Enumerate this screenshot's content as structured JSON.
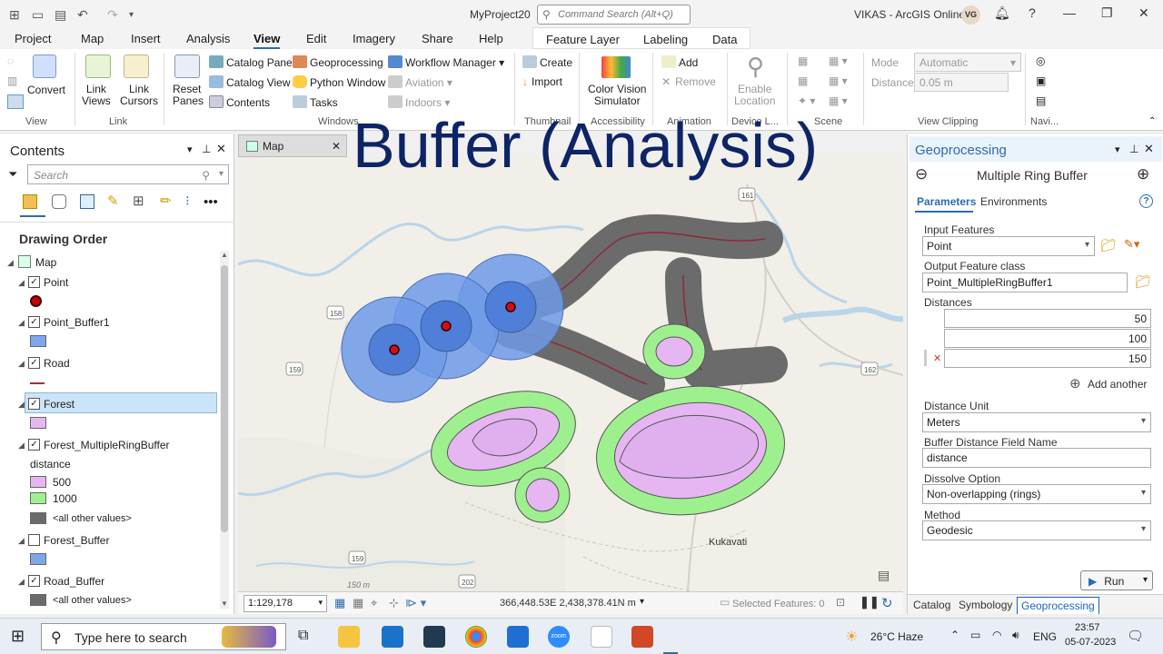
{
  "titlebar": {
    "project": "MyProject20",
    "search_placeholder": "Command Search (Alt+Q)",
    "account": "VIKAS - ArcGIS Online",
    "avatar": "VG",
    "help": "?"
  },
  "menu": {
    "items": [
      "Project",
      "Map",
      "Insert",
      "Analysis",
      "View",
      "Edit",
      "Imagery",
      "Share",
      "Help"
    ],
    "active": "View",
    "context_tabs": [
      "Feature Layer",
      "Labeling",
      "Data"
    ]
  },
  "ribbon": {
    "view_group": {
      "label": "View",
      "convert": "Convert"
    },
    "link_group": {
      "label": "Link",
      "link_views": "Link\nViews",
      "link_cursors": "Link\nCursors"
    },
    "windows_group": {
      "label": "Windows",
      "reset_panes": "Reset\nPanes",
      "catalog_pane": "Catalog Pane",
      "catalog_view": "Catalog View",
      "contents": "Contents",
      "geoprocessing": "Geoprocessing",
      "python_window": "Python Window",
      "tasks": "Tasks",
      "workflow_manager": "Workflow Manager",
      "aviation": "Aviation",
      "indoors": "Indoors"
    },
    "thumbnail_group": {
      "label": "Thumbnail",
      "create": "Create",
      "import": "Import"
    },
    "accessibility_group": {
      "label": "Accessibility",
      "cvs": "Color Vision\nSimulator"
    },
    "animation_group": {
      "label": "Animation",
      "add": "Add",
      "remove": "Remove"
    },
    "device_group": {
      "label": "Device L...",
      "enable": "Enable\nLocation"
    },
    "scene_group": {
      "label": "Scene"
    },
    "clipping_group": {
      "label": "View Clipping",
      "mode_label": "Mode",
      "mode_value": "Automatic",
      "distance_label": "Distance",
      "distance_value": "0.05  m"
    },
    "navi_group": {
      "label": "Navi..."
    }
  },
  "overlay_title": "Buffer (Analysis)",
  "contents": {
    "title": "Contents",
    "search_placeholder": "Search",
    "drawing_order": "Drawing Order",
    "map_label": "Map",
    "layers": [
      {
        "name": "Point",
        "checked": true
      },
      {
        "name": "Point_Buffer1",
        "checked": true
      },
      {
        "name": "Road",
        "checked": true
      },
      {
        "name": "Forest",
        "checked": true
      },
      {
        "name": "Forest_MultipleRingBuffer",
        "checked": true
      },
      {
        "name": "Forest_Buffer",
        "checked": false
      },
      {
        "name": "Road_Buffer",
        "checked": true
      }
    ],
    "ring_field": "distance",
    "ring_500": "500",
    "ring_1000": "1000",
    "other_values": "<all other values>",
    "other_values_2": "<all other values>"
  },
  "map": {
    "tab_label": "Map",
    "place_label": "Kukavati",
    "elevation_label": "150 m",
    "route_labels": [
      "158",
      "159",
      "162",
      "159",
      "202",
      "161"
    ],
    "scale": "1:129,178",
    "coords": "366,448.53E 2,438,378.41N m",
    "selected": "Selected Features: 0"
  },
  "geoprocessing": {
    "title": "Geoprocessing",
    "tool": "Multiple Ring Buffer",
    "tab_parameters": "Parameters",
    "tab_environments": "Environments",
    "input_label": "Input Features",
    "input_value": "Point",
    "output_label": "Output Feature class",
    "output_value": "Point_MultipleRingBuffer1",
    "distances_label": "Distances",
    "distances": [
      "50",
      "100",
      "150"
    ],
    "add_another": "Add another",
    "unit_label": "Distance Unit",
    "unit_value": "Meters",
    "field_label": "Buffer Distance Field Name",
    "field_value": "distance",
    "dissolve_label": "Dissolve Option",
    "dissolve_value": "Non-overlapping (rings)",
    "method_label": "Method",
    "method_value": "Geodesic",
    "run": "Run",
    "bottom_tabs": [
      "Catalog",
      "Symbology",
      "Geoprocessing"
    ]
  },
  "taskbar": {
    "search_placeholder": "Type here to search",
    "weather": "26°C  Haze",
    "lang": "ENG",
    "time": "23:57",
    "date": "05-07-2023",
    "zoom_label": "zoom"
  },
  "colors": {
    "accent": "#2b6cb0",
    "title_text": "#0d2466",
    "point_buffer": "#6f9ae8",
    "road_buffer": "#6b6b6b",
    "ring_500": "#e6b6f2",
    "ring_1000": "#9ef08f"
  }
}
